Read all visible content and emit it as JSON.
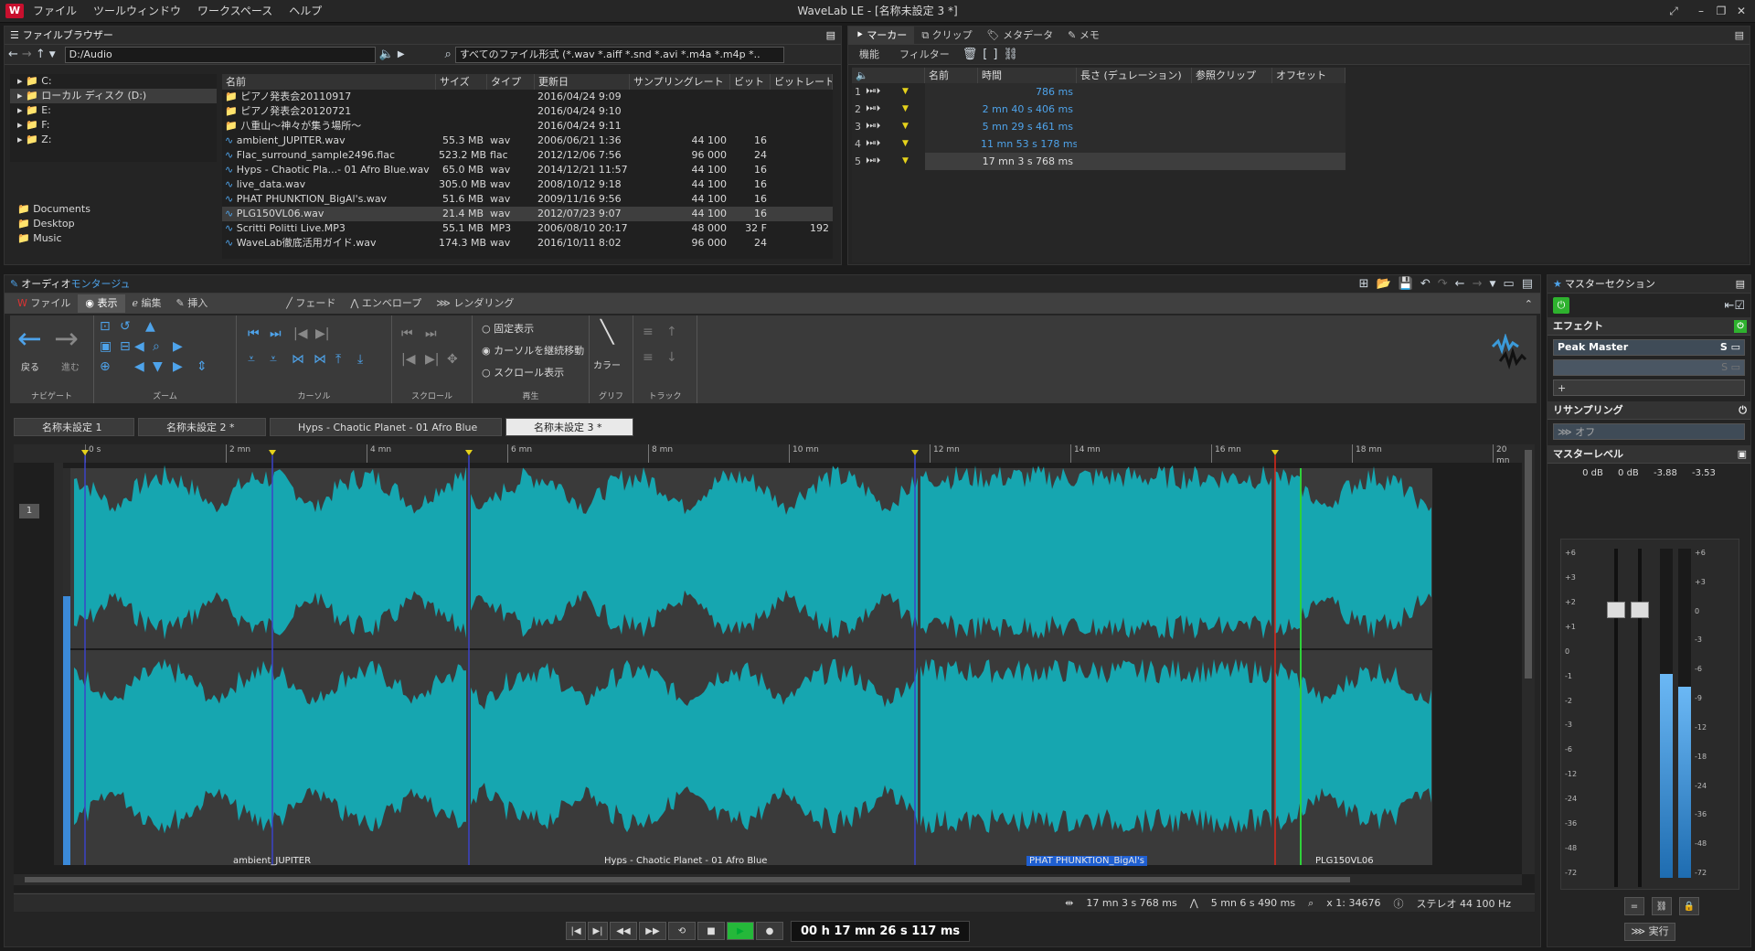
{
  "app": {
    "title": "WaveLab LE - [名称未設定 3 *]",
    "logo": "W",
    "menu": [
      "ファイル",
      "ツールウィンドウ",
      "ワークスペース",
      "ヘルプ"
    ]
  },
  "file_browser": {
    "title": "ファイルブラウザー",
    "path": "D:/Audio",
    "filter": "すべてのファイル形式 (*.wav *.aiff *.snd *.avi *.m4a *.m4p *..",
    "drives": [
      {
        "label": "C:",
        "selected": false
      },
      {
        "label": "ローカル ディスク (D:)",
        "selected": true
      },
      {
        "label": "E:",
        "selected": false
      },
      {
        "label": "F:",
        "selected": false
      },
      {
        "label": "Z:",
        "selected": false
      }
    ],
    "favorites": [
      "Documents",
      "Desktop",
      "Music"
    ],
    "columns": [
      "名前",
      "サイズ",
      "タイプ",
      "更新日",
      "サンプリングレート",
      "ビット",
      "ビットレート"
    ],
    "rows": [
      {
        "name": "ピアノ発表会20110917",
        "size": "",
        "type": "",
        "date": "2016/04/24 9:09",
        "rate": "",
        "bits": "",
        "bitrate": "",
        "folder": true
      },
      {
        "name": "ピアノ発表会20120721",
        "size": "",
        "type": "",
        "date": "2016/04/24 9:10",
        "rate": "",
        "bits": "",
        "bitrate": "",
        "folder": true
      },
      {
        "name": "八重山〜神々が集う場所〜",
        "size": "",
        "type": "",
        "date": "2016/04/24 9:11",
        "rate": "",
        "bits": "",
        "bitrate": "",
        "folder": true
      },
      {
        "name": "ambient_JUPITER.wav",
        "size": "55.3 MB",
        "type": "wav",
        "date": "2006/06/21 1:36",
        "rate": "44 100",
        "bits": "16",
        "bitrate": ""
      },
      {
        "name": "Flac_surround_sample2496.flac",
        "size": "523.2 MB",
        "type": "flac",
        "date": "2012/12/06 7:56",
        "rate": "96 000",
        "bits": "24",
        "bitrate": ""
      },
      {
        "name": "Hyps - Chaotic Pla...- 01 Afro Blue.wav",
        "size": "65.0 MB",
        "type": "wav",
        "date": "2014/12/21 11:57",
        "rate": "44 100",
        "bits": "16",
        "bitrate": ""
      },
      {
        "name": "live_data.wav",
        "size": "305.0 MB",
        "type": "wav",
        "date": "2008/10/12 9:18",
        "rate": "44 100",
        "bits": "16",
        "bitrate": ""
      },
      {
        "name": "PHAT PHUNKTION_BigAl's.wav",
        "size": "51.6 MB",
        "type": "wav",
        "date": "2009/11/16 9:56",
        "rate": "44 100",
        "bits": "16",
        "bitrate": ""
      },
      {
        "name": "PLG150VL06.wav",
        "size": "21.4 MB",
        "type": "wav",
        "date": "2012/07/23 9:07",
        "rate": "44 100",
        "bits": "16",
        "bitrate": "",
        "selected": true
      },
      {
        "name": "Scritti Politti Live.MP3",
        "size": "55.1 MB",
        "type": "MP3",
        "date": "2006/08/10 20:17",
        "rate": "48 000",
        "bits": "32 F",
        "bitrate": "192"
      },
      {
        "name": "WaveLab徹底活用ガイド.wav",
        "size": "174.3 MB",
        "type": "wav",
        "date": "2016/10/11 8:02",
        "rate": "96 000",
        "bits": "24",
        "bitrate": ""
      }
    ]
  },
  "marker_panel": {
    "tabs": [
      "マーカー",
      "クリップ",
      "メタデータ",
      "メモ"
    ],
    "toolbar": [
      "機能",
      "フィルター"
    ],
    "columns": [
      "名前",
      "時間",
      "長さ (デュレーション)",
      "参照クリップ",
      "オフセット"
    ],
    "rows": [
      {
        "num": "1",
        "time": "786 ms"
      },
      {
        "num": "2",
        "time": "2 mn 40 s 406 ms"
      },
      {
        "num": "3",
        "time": "5 mn 29 s 461 ms"
      },
      {
        "num": "4",
        "time": "11 mn 53 s 178 ms"
      },
      {
        "num": "5",
        "time": "17 mn 3 s 768 ms",
        "selected": true
      }
    ]
  },
  "audio_montage": {
    "title_a": "オーディオ",
    "title_b": "モンタージュ",
    "ribbon_tabs": [
      "ファイル",
      "表示",
      "編集",
      "挿入",
      "フェード",
      "エンベロープ",
      "レンダリング"
    ],
    "groups": [
      "ナビゲート",
      "ズーム",
      "カーソル",
      "スクロール",
      "再生",
      "グリフ",
      "トラック"
    ],
    "nav_back": "戻る",
    "nav_forward": "進む",
    "playback_options": [
      "固定表示",
      "カーソルを継続移動",
      "スクロール表示"
    ],
    "color_label": "カラー",
    "doc_tabs": [
      "名称未設定 1",
      "名称未設定 2 *",
      "Hyps - Chaotic Planet - 01 Afro Blue",
      "名称未設定 3 *"
    ],
    "ruler_ticks": [
      "0 s",
      "2 mn",
      "4 mn",
      "6 mn",
      "8 mn",
      "10 mn",
      "12 mn",
      "14 mn",
      "16 mn",
      "18 mn",
      "20 mn"
    ],
    "track_number": "1",
    "clips": [
      "ambient_JUPITER",
      "Hyps - Chaotic Planet - 01 Afro Blue",
      "PHAT PHUNKTION_BigAl's",
      "PLG150VL06"
    ],
    "status": {
      "cursor": "17 mn 3 s 768 ms",
      "length": "5 mn 6 s 490 ms",
      "zoom": "x 1: 34676",
      "format": "ステレオ 44 100 Hz"
    },
    "transport_time": "00 h 17 mn 26 s 117 ms"
  },
  "master_section": {
    "title": "マスターセクション",
    "effects_label": "エフェクト",
    "plugin": "Peak Master",
    "resampling_label": "リサンプリング",
    "resampling_value": "オフ",
    "master_level_label": "マスターレベル",
    "levels": [
      "0 dB",
      "0 dB",
      "-3.88",
      "-3.53"
    ],
    "scale_left": [
      "+6",
      "+3",
      "+2",
      "+1",
      "0",
      "-1",
      "-2",
      "-3",
      "-6",
      "-12",
      "-24",
      "-36",
      "-48",
      "-72"
    ],
    "scale_right": [
      "+6",
      "+3",
      "0",
      "-3",
      "-6",
      "-9",
      "-12",
      "-18",
      "-24",
      "-36",
      "-48",
      "-72"
    ],
    "meter_left": 0.62,
    "meter_right": 0.58,
    "execute_label": "実行"
  },
  "colors": {
    "wave": "#16a6b0",
    "accent": "#4ea3ea",
    "marker": "#e5d21b",
    "play": "#25b83a",
    "power": "#2eb22e"
  }
}
